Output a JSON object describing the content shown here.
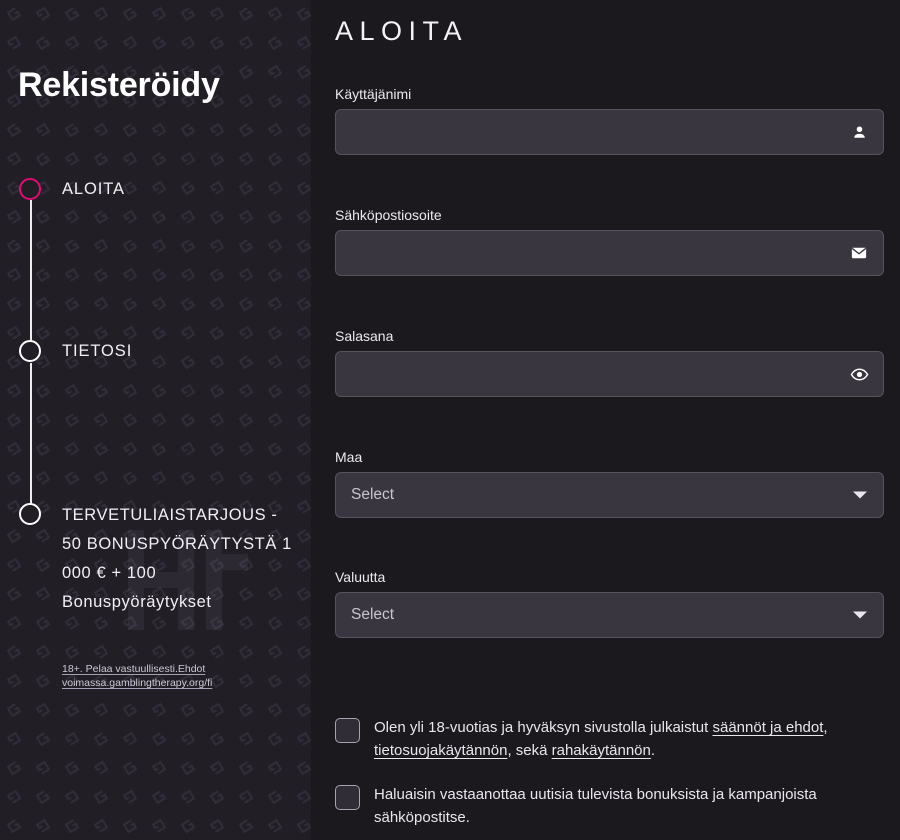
{
  "sidebar": {
    "brand_title": "Rekisteröidy",
    "accent_color": "#e00b73",
    "steps": [
      {
        "label": "ALOITA",
        "state": "active"
      },
      {
        "label": "TIETOSI",
        "state": "upcoming"
      },
      {
        "label": "TERVETULIAISTARJOUS - 50 BONUSPYÖRÄYTYSTÄ 1 000 € + 100 ",
        "label_tail": "Bonuspyöräytykset",
        "state": "upcoming"
      }
    ],
    "legal_note": "18+. Pelaa vastuullisesti.Ehdot voimassa.gamblingtherapy.org/fi"
  },
  "form": {
    "title": "ALOITA",
    "fields": [
      {
        "label": "Käyttäjänimi",
        "value": "",
        "placeholder": "",
        "icon": "person-icon",
        "type": "text"
      },
      {
        "label": "Sähköpostiosoite",
        "value": "",
        "placeholder": "",
        "icon": "envelope-icon",
        "type": "email"
      },
      {
        "label": "Salasana",
        "value": "",
        "placeholder": "",
        "icon": "eye-icon",
        "type": "password"
      }
    ],
    "selects": [
      {
        "label": "Maa",
        "value": "Select",
        "icon": "chevron-down-icon"
      },
      {
        "label": "Valuutta",
        "value": "Select",
        "icon": "chevron-down-icon"
      }
    ],
    "checkboxes": [
      {
        "checked": false,
        "segments": [
          {
            "text": "Olen yli 18-vuotias ja hyväksyn sivustolla julkaistut ",
            "link": false
          },
          {
            "text": "säännöt ja ehdot",
            "link": true
          },
          {
            "text": ", ",
            "link": false
          },
          {
            "text": "tietosuojakäytännön",
            "link": true
          },
          {
            "text": ", sekä ",
            "link": false
          },
          {
            "text": "rahakäytännön",
            "link": true
          },
          {
            "text": ".",
            "link": false
          }
        ]
      },
      {
        "checked": false,
        "segments": [
          {
            "text": "Haluaisin vastaanottaa uutisia tulevista bonuksista ja kampanjoista sähköpostitse.",
            "link": false
          }
        ]
      }
    ]
  }
}
